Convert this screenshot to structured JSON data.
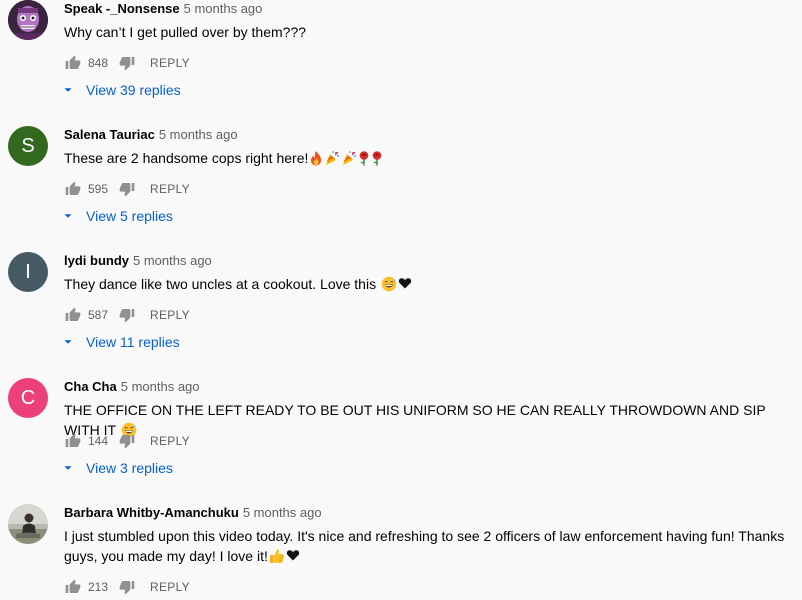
{
  "comments": [
    {
      "author": "Speak -_Nonsense",
      "time": "5 months ago",
      "text": "Why can’t I get pulled over by them???",
      "likes": "848",
      "reply_label": "REPLY",
      "view_replies": "View 39 replies",
      "avatar_type": "image",
      "avatar_color": "#7a3a7e"
    },
    {
      "author": "Salena Tauriac",
      "time": "5 months ago",
      "text": "These are 2 handsome cops right here!",
      "emojis": [
        "fire-emoji",
        "party-popper-emoji",
        "party-popper-emoji",
        "rose-emoji",
        "rose-emoji"
      ],
      "likes": "595",
      "reply_label": "REPLY",
      "view_replies": "View 5 replies",
      "avatar_type": "letter",
      "avatar_letter": "S",
      "avatar_color": "#33691e"
    },
    {
      "author": "lydi bundy",
      "time": "5 months ago",
      "text": "They dance like two uncles at a cookout. Love this ",
      "emojis": [
        "grinning-sweat-emoji",
        "black-heart-emoji"
      ],
      "likes": "587",
      "reply_label": "REPLY",
      "view_replies": "View 11 replies",
      "avatar_type": "letter",
      "avatar_letter": "I",
      "avatar_color": "#455a64"
    },
    {
      "author": "Cha Cha",
      "time": "5 months ago",
      "text": "THE OFFICE ON THE LEFT READY TO BE OUT HIS UNIFORM SO HE CAN REALLY THROWDOWN AND SIP WITH IT ",
      "emojis": [
        "grinning-sweat-emoji"
      ],
      "likes": "144",
      "reply_label": "REPLY",
      "view_replies": "View 3 replies",
      "avatar_type": "letter",
      "avatar_letter": "C",
      "avatar_color": "#ec407a"
    },
    {
      "author": "Barbara Whitby-Amanchuku",
      "time": "5 months ago",
      "text": "I just stumbled upon this video today. It's nice and refreshing to see 2 officers of law enforcement having fun! Thanks guys, you made my day! I love it!",
      "emojis": [
        "thumbs-up-emoji",
        "black-heart-emoji"
      ],
      "likes": "213",
      "reply_label": "REPLY",
      "avatar_type": "photo",
      "avatar_color": "#9e9e9e"
    }
  ],
  "colors": {
    "background": "#f9f9f9",
    "text": "#030303",
    "secondary_text": "#606060",
    "link": "#065fd4",
    "icon": "#909090"
  },
  "icons": {
    "like": "thumbs-up-icon",
    "dislike": "thumbs-down-icon",
    "expand": "chevron-down-icon"
  }
}
